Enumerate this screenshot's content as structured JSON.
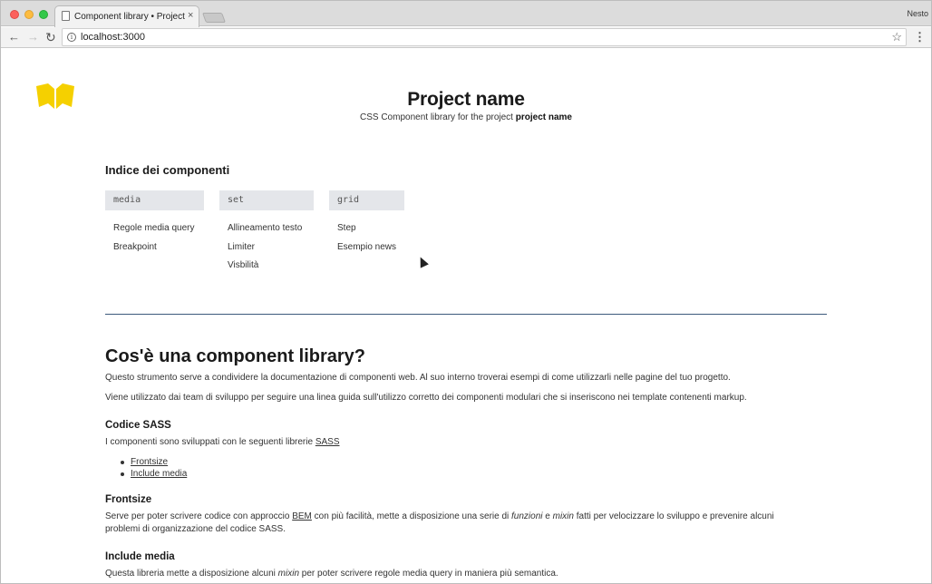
{
  "browser": {
    "tab_title": "Component library • Project name",
    "tab_close": "×",
    "profile_name": "Nesto",
    "url": "localhost:3000",
    "icons": {
      "back": "arrow-left-icon",
      "forward": "arrow-right-icon",
      "reload": "reload-icon",
      "info": "info-icon",
      "star": "star-icon",
      "menu": "kebab-menu-icon"
    }
  },
  "header": {
    "logo": "book-logo",
    "title": "Project name",
    "subtitle_prefix": "CSS Component library for the project",
    "subtitle_bold": "project name"
  },
  "index": {
    "title": "Indice dei componenti",
    "columns": [
      {
        "tag": "media",
        "links": [
          "Regole media query",
          "Breakpoint"
        ]
      },
      {
        "tag": "set",
        "links": [
          "Allineamento testo",
          "Limiter",
          "Visbilità"
        ]
      },
      {
        "tag": "grid",
        "links": [
          "Step",
          "Esempio news"
        ]
      }
    ]
  },
  "intro": {
    "title": "Cos'è una component library?",
    "p1": "Questo strumento serve a condividere la documentazione di componenti web. Al suo interno troverai esempi di come utilizzarli nelle pagine del tuo progetto.",
    "p2": "Viene utilizzato dai team di sviluppo per seguire una linea guida sull'utilizzo corretto dei componenti modulari che si inseriscono nei template contenenti markup."
  },
  "sass": {
    "title": "Codice SASS",
    "text_prefix": "I componenti sono sviluppati con le seguenti librerie",
    "link": "SASS",
    "libs": [
      "Frontsize",
      "Include media"
    ]
  },
  "frontsize": {
    "title": "Frontsize",
    "t1": "Serve per poter scrivere codice con approccio",
    "bem": "BEM",
    "t2": "con più facilità, mette a disposizione una serie di",
    "funzioni": "funzioni",
    "e": "e",
    "mixin": "mixin",
    "t3": "fatti per velocizzare lo sviluppo e prevenire alcuni",
    "line2": "problemi di organizzazione del codice SASS."
  },
  "include_media": {
    "title": "Include media",
    "t1": "Questa libreria mette a disposizione alcuni",
    "mixin": "mixin",
    "t2": "per poter scrivere regole media query in maniera più semantica."
  },
  "colors": {
    "logo": "#f5d000",
    "divider": "#3c5a7c",
    "tag_bg": "#e4e6ea"
  }
}
